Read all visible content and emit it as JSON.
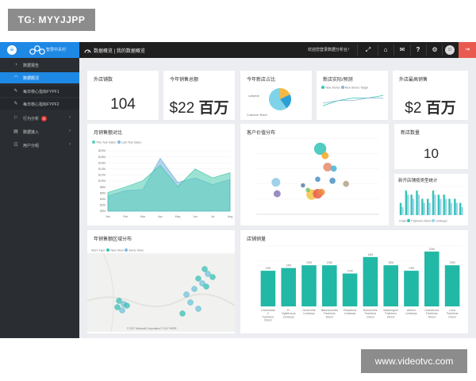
{
  "watermark": {
    "top": "TG: MYYJJPP",
    "bottom": "www.videotvc.com"
  },
  "topbar": {
    "app_title": "智慧中关村",
    "breadcrumb": "数据概览 | 我的数据概览",
    "welcome": "欢迎您登录数据分析台！"
  },
  "sidebar": {
    "items": [
      {
        "label": "数据报告",
        "icon": "report-icon"
      },
      {
        "label": "数据概况",
        "icon": "overview-icon"
      },
      {
        "label": "每日核心指标FYPF1",
        "icon": "pin-icon"
      },
      {
        "label": "每日核心指标FYPF2",
        "icon": "pin-icon"
      },
      {
        "label": "行为分析",
        "icon": "behavior-icon",
        "badge": "8"
      },
      {
        "label": "数据接入",
        "icon": "data-icon"
      },
      {
        "label": "用户分组",
        "icon": "users-icon"
      }
    ]
  },
  "kpis": {
    "store_count": {
      "title": "外店铺数",
      "value": "104"
    },
    "sales_amount": {
      "title": "今年销售总额",
      "prefix": "$22",
      "unit": "百万"
    },
    "new_stores_ratio": {
      "title": "今年新店占比",
      "label_a": "Lastyear",
      "label_b": "Customer Brazil"
    },
    "store_actual_target": {
      "title": "新店实际/预测",
      "legend_a": "New Stores",
      "legend_b": "New Stores Target"
    },
    "store_max_sales": {
      "title": "外店最高销售",
      "prefix": "$2",
      "unit": "百万"
    },
    "new_store_count": {
      "title": "新店数量",
      "value": "10"
    }
  },
  "charts": {
    "sales_compare": {
      "title": "月销售额对比",
      "legend_a": "This Year Sales",
      "legend_b": "Last Year Sales"
    },
    "customer_dist": {
      "title": "客户价值分布"
    },
    "region_dist": {
      "title": "年销售额区域分布",
      "store_type": "Store Type",
      "legend_a": "New Store",
      "legend_b": "Same Store",
      "credit": "© 2017 Microsoft Corporation  © 2017 HERE"
    },
    "new_store_type": {
      "title": "新开店铺按类型统计",
      "legend_label": "Chain",
      "legend_a": "Fashions Direct",
      "legend_b": "Lindseys"
    },
    "store_sales": {
      "title": "店铺销量"
    }
  },
  "chart_data": [
    {
      "type": "area",
      "title": "月销售额对比",
      "categories": [
        "Jan",
        "Feb",
        "Mar",
        "Apr",
        "May",
        "Jun",
        "Jul",
        "Aug"
      ],
      "series": [
        {
          "name": "This Year Sales",
          "values": [
            6.2,
            8.0,
            10.1,
            15.2,
            8.1,
            14.0,
            11.0,
            12.8
          ]
        },
        {
          "name": "Last Year Sales",
          "values": [
            5.0,
            6.8,
            7.2,
            17.5,
            9.5,
            11.0,
            8.8,
            10.5
          ]
        }
      ],
      "ylim": [
        0,
        20
      ],
      "y_ticks": [
        "$20M",
        "$18M",
        "$16M",
        "$14M",
        "$12M",
        "$10M",
        "$8M",
        "$6M",
        "$4M",
        "$2M",
        "$0M"
      ]
    },
    {
      "type": "scatter",
      "title": "客户价值分布",
      "points": [
        {
          "x": 52,
          "y": 86,
          "r": 7,
          "color": "#34c3b5"
        },
        {
          "x": 56,
          "y": 77,
          "r": 4,
          "color": "#f5a623"
        },
        {
          "x": 58,
          "y": 62,
          "r": 5,
          "color": "#e8896a"
        },
        {
          "x": 63,
          "y": 60,
          "r": 3.5,
          "color": "#43b3d6"
        },
        {
          "x": 16,
          "y": 42,
          "r": 5,
          "color": "#8ecae6"
        },
        {
          "x": 38,
          "y": 38,
          "r": 2.5,
          "color": "#5a7fa8"
        },
        {
          "x": 50,
          "y": 46,
          "r": 3,
          "color": "#4a90c2"
        },
        {
          "x": 62,
          "y": 44,
          "r": 3.5,
          "color": "#4a90c2"
        },
        {
          "x": 73,
          "y": 40,
          "r": 3.5,
          "color": "#b5a38a"
        },
        {
          "x": 17,
          "y": 27,
          "r": 4,
          "color": "#8a7ab8"
        },
        {
          "x": 45,
          "y": 26,
          "r": 6,
          "color": "#f5c242"
        },
        {
          "x": 50,
          "y": 27,
          "r": 5.5,
          "color": "#e85a4f"
        },
        {
          "x": 53,
          "y": 29,
          "r": 4,
          "color": "#f08a3c"
        },
        {
          "x": 42,
          "y": 32,
          "r": 2.5,
          "color": "#77c36b"
        }
      ]
    },
    {
      "type": "pie",
      "title": "今年新店占比",
      "slices": [
        {
          "label": "Lastyear",
          "value": 18,
          "color": "#f5b942"
        },
        {
          "label": "New",
          "value": 22,
          "color": "#2a9fd6"
        },
        {
          "label": "Customer Brazil",
          "value": 60,
          "color": "#7fd3e8"
        }
      ]
    },
    {
      "type": "bar",
      "title": "新开店铺按类型统计",
      "categories": [
        "1",
        "2",
        "3",
        "4",
        "5",
        "6",
        "7",
        "8",
        "9",
        "10",
        "11",
        "12"
      ],
      "series": [
        {
          "name": "Fashions Direct",
          "values": [
            3,
            6,
            5,
            6,
            4,
            4,
            6,
            5,
            5,
            4,
            4,
            3
          ]
        },
        {
          "name": "Lindseys",
          "values": [
            2,
            5,
            4,
            5,
            3,
            3,
            5,
            4,
            4,
            3,
            3,
            2
          ]
        }
      ],
      "ylim": [
        0,
        7
      ]
    },
    {
      "type": "bar",
      "title": "店铺销量",
      "categories": [
        "Universitas 2 Fashions Direct",
        "Ft. Oglethorpe Lindseys",
        "Greenville Lindseys",
        "Bakersonville Fashions Direct",
        "Pasadena Lindseys",
        "Beaverville Fashions Direct",
        "Washington Fashions Direct",
        "Athens Lindseys",
        "Grandmont Fashions Direct",
        "Linia Fashions Direct"
      ],
      "values": [
        13,
        14,
        15,
        15,
        12,
        18,
        15,
        13,
        20,
        15
      ],
      "ylim": [
        0,
        22
      ]
    },
    {
      "type": "line",
      "title": "新店实际/预测",
      "series": [
        {
          "name": "New Stores",
          "values": [
            3,
            5,
            6,
            6,
            7
          ]
        },
        {
          "name": "New Stores Target",
          "values": [
            4,
            5,
            5,
            6,
            6
          ]
        }
      ]
    }
  ]
}
